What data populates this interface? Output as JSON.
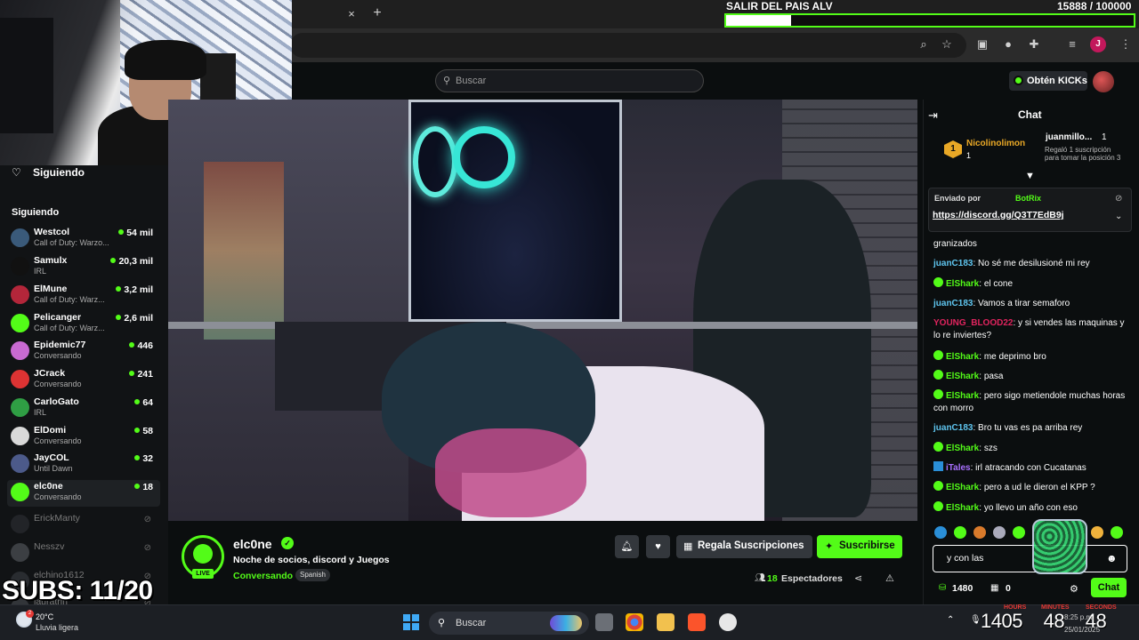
{
  "overlay": {
    "goal_title": "SALIR DEL PAIS ALV",
    "goal_count": "15888  / 100000",
    "goal_progress": 0.159,
    "subs_goal": "SUBS: 11/20"
  },
  "browser": {
    "tab_close": "×",
    "tab_new": "+"
  },
  "header": {
    "search_placeholder": "Buscar",
    "kicks_button": "Obtén KICKs"
  },
  "sidebar": {
    "top_label": "Siguiendo",
    "section_label": "Siguiendo",
    "channels": [
      {
        "name": "Westcol",
        "category": "Call of Duty: Warzo...",
        "viewers": "54 mil",
        "color": "#3a5a7a"
      },
      {
        "name": "Samulx",
        "category": "IRL",
        "viewers": "20,3 mil",
        "color": "#111111"
      },
      {
        "name": "ElMune",
        "category": "Call of Duty: Warz...",
        "viewers": "3,2 mil",
        "color": "#b3263a"
      },
      {
        "name": "Pelicanger",
        "category": "Call of Duty: Warz...",
        "viewers": "2,6 mil",
        "color": "#53fc18"
      },
      {
        "name": "Epidemic77",
        "category": "Conversando",
        "viewers": "446",
        "color": "#c86ad1"
      },
      {
        "name": "JCrack",
        "category": "Conversando",
        "viewers": "241",
        "color": "#d33"
      },
      {
        "name": "CarloGato",
        "category": "IRL",
        "viewers": "64",
        "color": "#2f9e44"
      },
      {
        "name": "ElDomi",
        "category": "Conversando",
        "viewers": "58",
        "color": "#d9d9d9"
      },
      {
        "name": "JayCOL",
        "category": "Until Dawn",
        "viewers": "32",
        "color": "#4c5a8a"
      },
      {
        "name": "elc0ne",
        "category": "Conversando",
        "viewers": "18",
        "color": "#53fc18"
      }
    ],
    "offline": [
      {
        "name": "ErickManty",
        "color": "#2e3135"
      },
      {
        "name": "Nesszv",
        "color": "#5a5d62"
      },
      {
        "name": "elchino1612",
        "color": "#3b3e42"
      },
      {
        "name": "lauratrin",
        "color": "#4a4d52"
      }
    ]
  },
  "stream": {
    "streamer": "elc0ne",
    "title": "Noche de socios, discord y Juegos",
    "category": "Conversando",
    "tag": "Spanish",
    "live_label": "LIVE",
    "gift_label": "Regala Suscripciones",
    "subscribe_label": "Suscribirse",
    "viewers_count": "18",
    "viewers_label": "Espectadores"
  },
  "chat": {
    "title": "Chat",
    "pinned": {
      "user": "Nicolinolimon",
      "badge": "1",
      "count": "1",
      "gifter": "juanmillo...",
      "gifter_count": "1",
      "note": "Regaló 1 suscripción para tomar la posición 3"
    },
    "sent_by_label": "Enviado por",
    "sent_by_bot": "BotRix",
    "sent_link": "https://discord.gg/Q3T7EdB9j",
    "messages": [
      {
        "user": "",
        "color": "#fff",
        "badge": "",
        "text": "granizados"
      },
      {
        "user": "juanC183",
        "color": "#5fc6f0",
        "badge": "",
        "text": "No sé me desilusioné mi rey"
      },
      {
        "user": "ElShark",
        "color": "#53fc18",
        "badge": "g",
        "text": "el cone"
      },
      {
        "user": "juanC183",
        "color": "#5fc6f0",
        "badge": "",
        "text": "Vamos a tirar semaforo"
      },
      {
        "user": "YOUNG_BLOOD22",
        "color": "#e0245e",
        "badge": "",
        "text": "y si vendes las maquinas y lo re inviertes?"
      },
      {
        "user": "ElShark",
        "color": "#53fc18",
        "badge": "g",
        "text": "me deprimo bro"
      },
      {
        "user": "ElShark",
        "color": "#53fc18",
        "badge": "g",
        "text": "pasa"
      },
      {
        "user": "ElShark",
        "color": "#53fc18",
        "badge": "g",
        "text": "pero sigo metiendole muchas horas con morro"
      },
      {
        "user": "juanC183",
        "color": "#5fc6f0",
        "badge": "",
        "text": "Bro tu vas es pa arriba rey"
      },
      {
        "user": "ElShark",
        "color": "#53fc18",
        "badge": "g",
        "text": "szs"
      },
      {
        "user": "iTales",
        "color": "#a970ff",
        "badge": "b",
        "text": "irl atracando con Cucatanas"
      },
      {
        "user": "ElShark",
        "color": "#53fc18",
        "badge": "g",
        "text": "pero a ud le dieron el KPP ?"
      },
      {
        "user": "ElShark",
        "color": "#53fc18",
        "badge": "g",
        "text": "yo llevo un año con eso"
      }
    ],
    "input_value": "y con las",
    "kicks_count": "1480",
    "gift_count": "0",
    "send_label": "Chat"
  },
  "taskbar": {
    "temperature": "20°C",
    "weather": "Lluvia ligera",
    "weather_badge": "2",
    "search_label": "Buscar",
    "clock_hours": "14",
    "clock_minutes": "05",
    "clock_seconds": "48",
    "clock_seconds2": "48",
    "label_hours": "HOURS",
    "label_minutes": "MINUTES",
    "label_seconds": "SECONDS",
    "small_time": "8:25 p.m.",
    "date": "25/01/2025"
  }
}
